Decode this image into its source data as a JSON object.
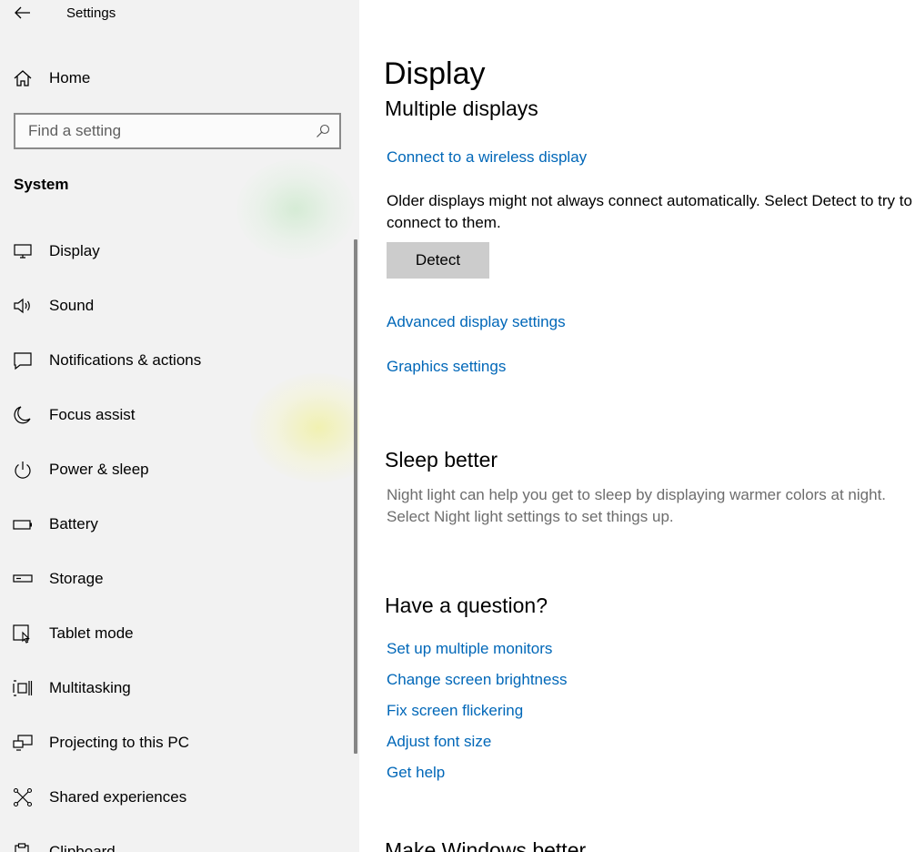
{
  "window": {
    "title": "Settings"
  },
  "sidebar": {
    "home_label": "Home",
    "search_placeholder": "Find a setting",
    "section_label": "System",
    "items": [
      {
        "label": "Display",
        "icon": "monitor-icon"
      },
      {
        "label": "Sound",
        "icon": "speaker-icon"
      },
      {
        "label": "Notifications & actions",
        "icon": "notification-icon"
      },
      {
        "label": "Focus assist",
        "icon": "moon-icon"
      },
      {
        "label": "Power & sleep",
        "icon": "power-icon"
      },
      {
        "label": "Battery",
        "icon": "battery-icon"
      },
      {
        "label": "Storage",
        "icon": "storage-icon"
      },
      {
        "label": "Tablet mode",
        "icon": "tablet-mode-icon"
      },
      {
        "label": "Multitasking",
        "icon": "multitasking-icon"
      },
      {
        "label": "Projecting to this PC",
        "icon": "projecting-icon"
      },
      {
        "label": "Shared experiences",
        "icon": "shared-experiences-icon"
      },
      {
        "label": "Clipboard",
        "icon": "clipboard-icon"
      }
    ]
  },
  "main": {
    "page_title": "Display",
    "multiple_displays": {
      "heading": "Multiple displays",
      "connect_link": "Connect to a wireless display",
      "description": "Older displays might not always connect automatically. Select Detect to try to connect to them.",
      "detect_button": "Detect",
      "advanced_link": "Advanced display settings",
      "graphics_link": "Graphics settings"
    },
    "sleep_better": {
      "heading": "Sleep better",
      "description": "Night light can help you get to sleep by displaying warmer colors at night. Select Night light settings to set things up."
    },
    "have_a_question": {
      "heading": "Have a question?",
      "links": [
        "Set up multiple monitors",
        "Change screen brightness",
        "Fix screen flickering",
        "Adjust font size",
        "Get help"
      ]
    },
    "make_windows_better": {
      "heading": "Make Windows better"
    }
  },
  "colors": {
    "accent": "#0067b8",
    "sidebar_bg": "#f2f2f2",
    "button_bg": "#cccccc"
  }
}
